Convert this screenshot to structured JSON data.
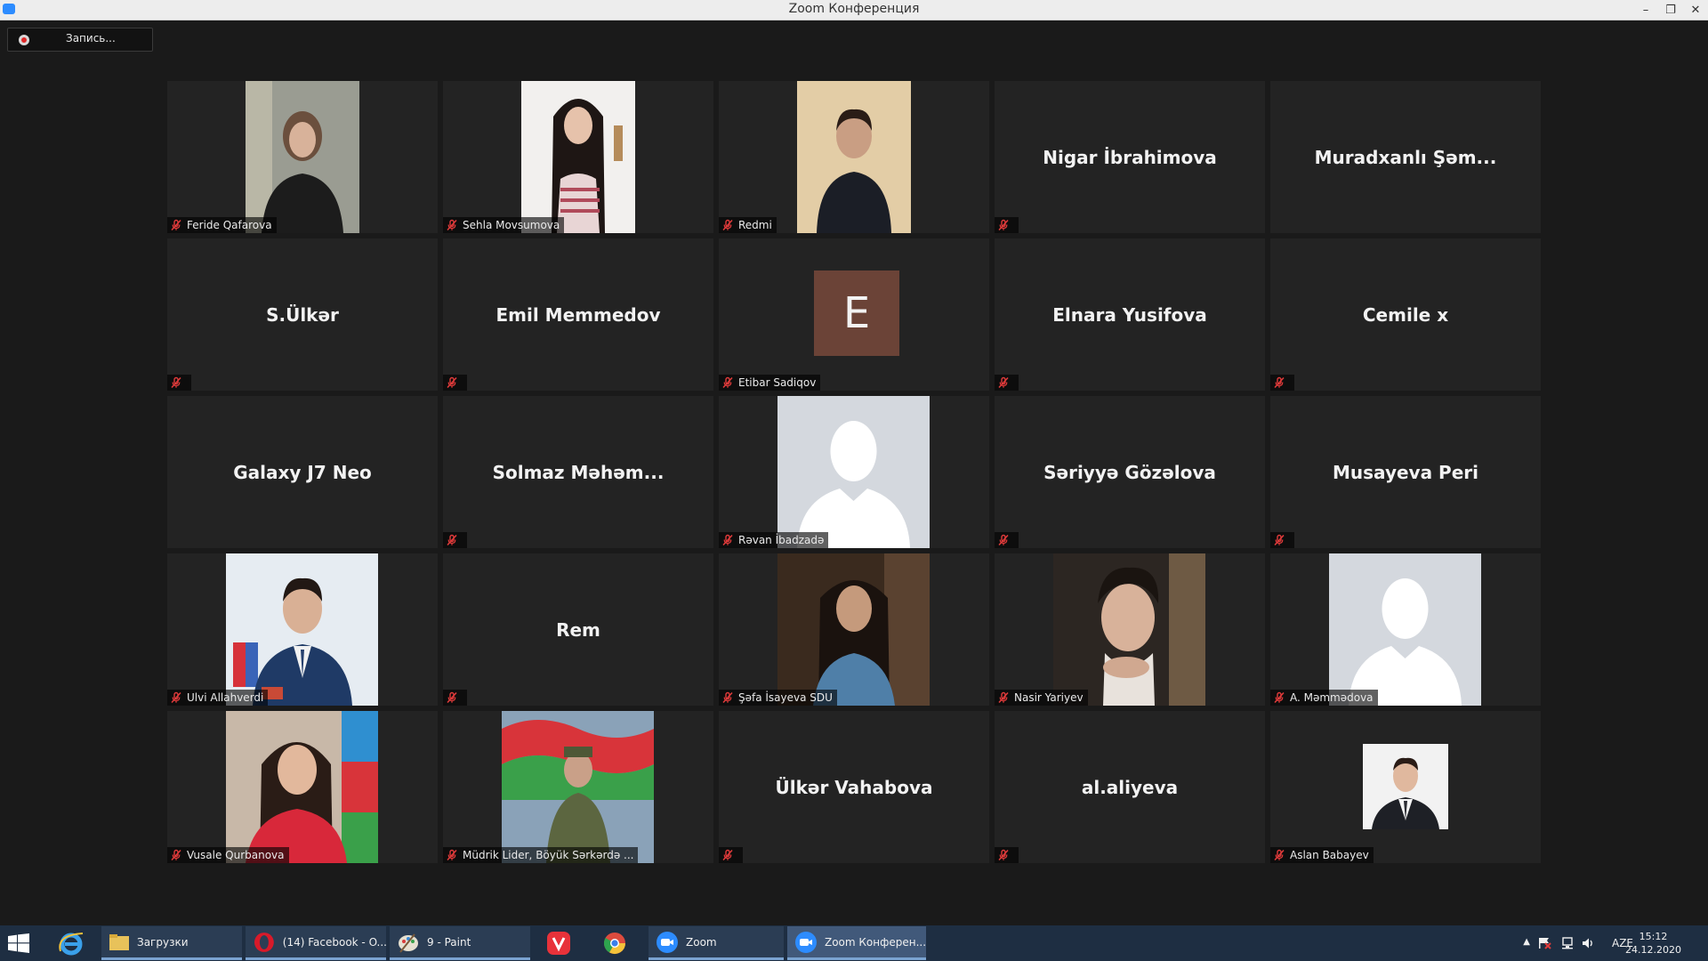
{
  "window": {
    "title": "Zoom Конференция",
    "minimize": "–",
    "restore": "❐",
    "close": "✕"
  },
  "recording": {
    "label": "Запись..."
  },
  "participants": [
    {
      "name": "Feride Qafarova"
    },
    {
      "name": "Sehla Movsumova"
    },
    {
      "name": "Redmi"
    },
    {
      "name": "Nigar İbrahimova"
    },
    {
      "name": "Muradxanlı  Şəm..."
    },
    {
      "name": "S.Ülkər"
    },
    {
      "name": "Emil Memmedov"
    },
    {
      "name": "Etibar Sadiqov",
      "initial": "E"
    },
    {
      "name": "Elnara Yusifova"
    },
    {
      "name": "Cemile x"
    },
    {
      "name": "Galaxy J7 Neo"
    },
    {
      "name": "Solmaz  Məhəm..."
    },
    {
      "name": "Rəvan İbadzadə"
    },
    {
      "name": "Səriyyə Gözəlova"
    },
    {
      "name": "Musayeva Peri"
    },
    {
      "name": "Ulvi Allahverdi"
    },
    {
      "name": "Rem"
    },
    {
      "name": "Şəfa İsayeva SDU"
    },
    {
      "name": "Nasir Yariyev"
    },
    {
      "name": "A. Məmmədova"
    },
    {
      "name": "Vusale Qurbanova"
    },
    {
      "name": "Müdrik Lider, Böyük Sərkərdə ..."
    },
    {
      "name": "Ülkər Vahabova"
    },
    {
      "name": "al.aliyeva"
    },
    {
      "name": "Aslan Babayev"
    }
  ],
  "taskbar": {
    "tasks": [
      {
        "label": "Загрузки"
      },
      {
        "label": "(14) Facebook - O..."
      },
      {
        "label": "9 - Paint"
      },
      {
        "label": "Zoom"
      },
      {
        "label": "Zoom Конферен..."
      }
    ],
    "tray": {
      "language": "AZE",
      "time": "15:12",
      "date": "24.12.2020",
      "overflow": "▲"
    }
  }
}
